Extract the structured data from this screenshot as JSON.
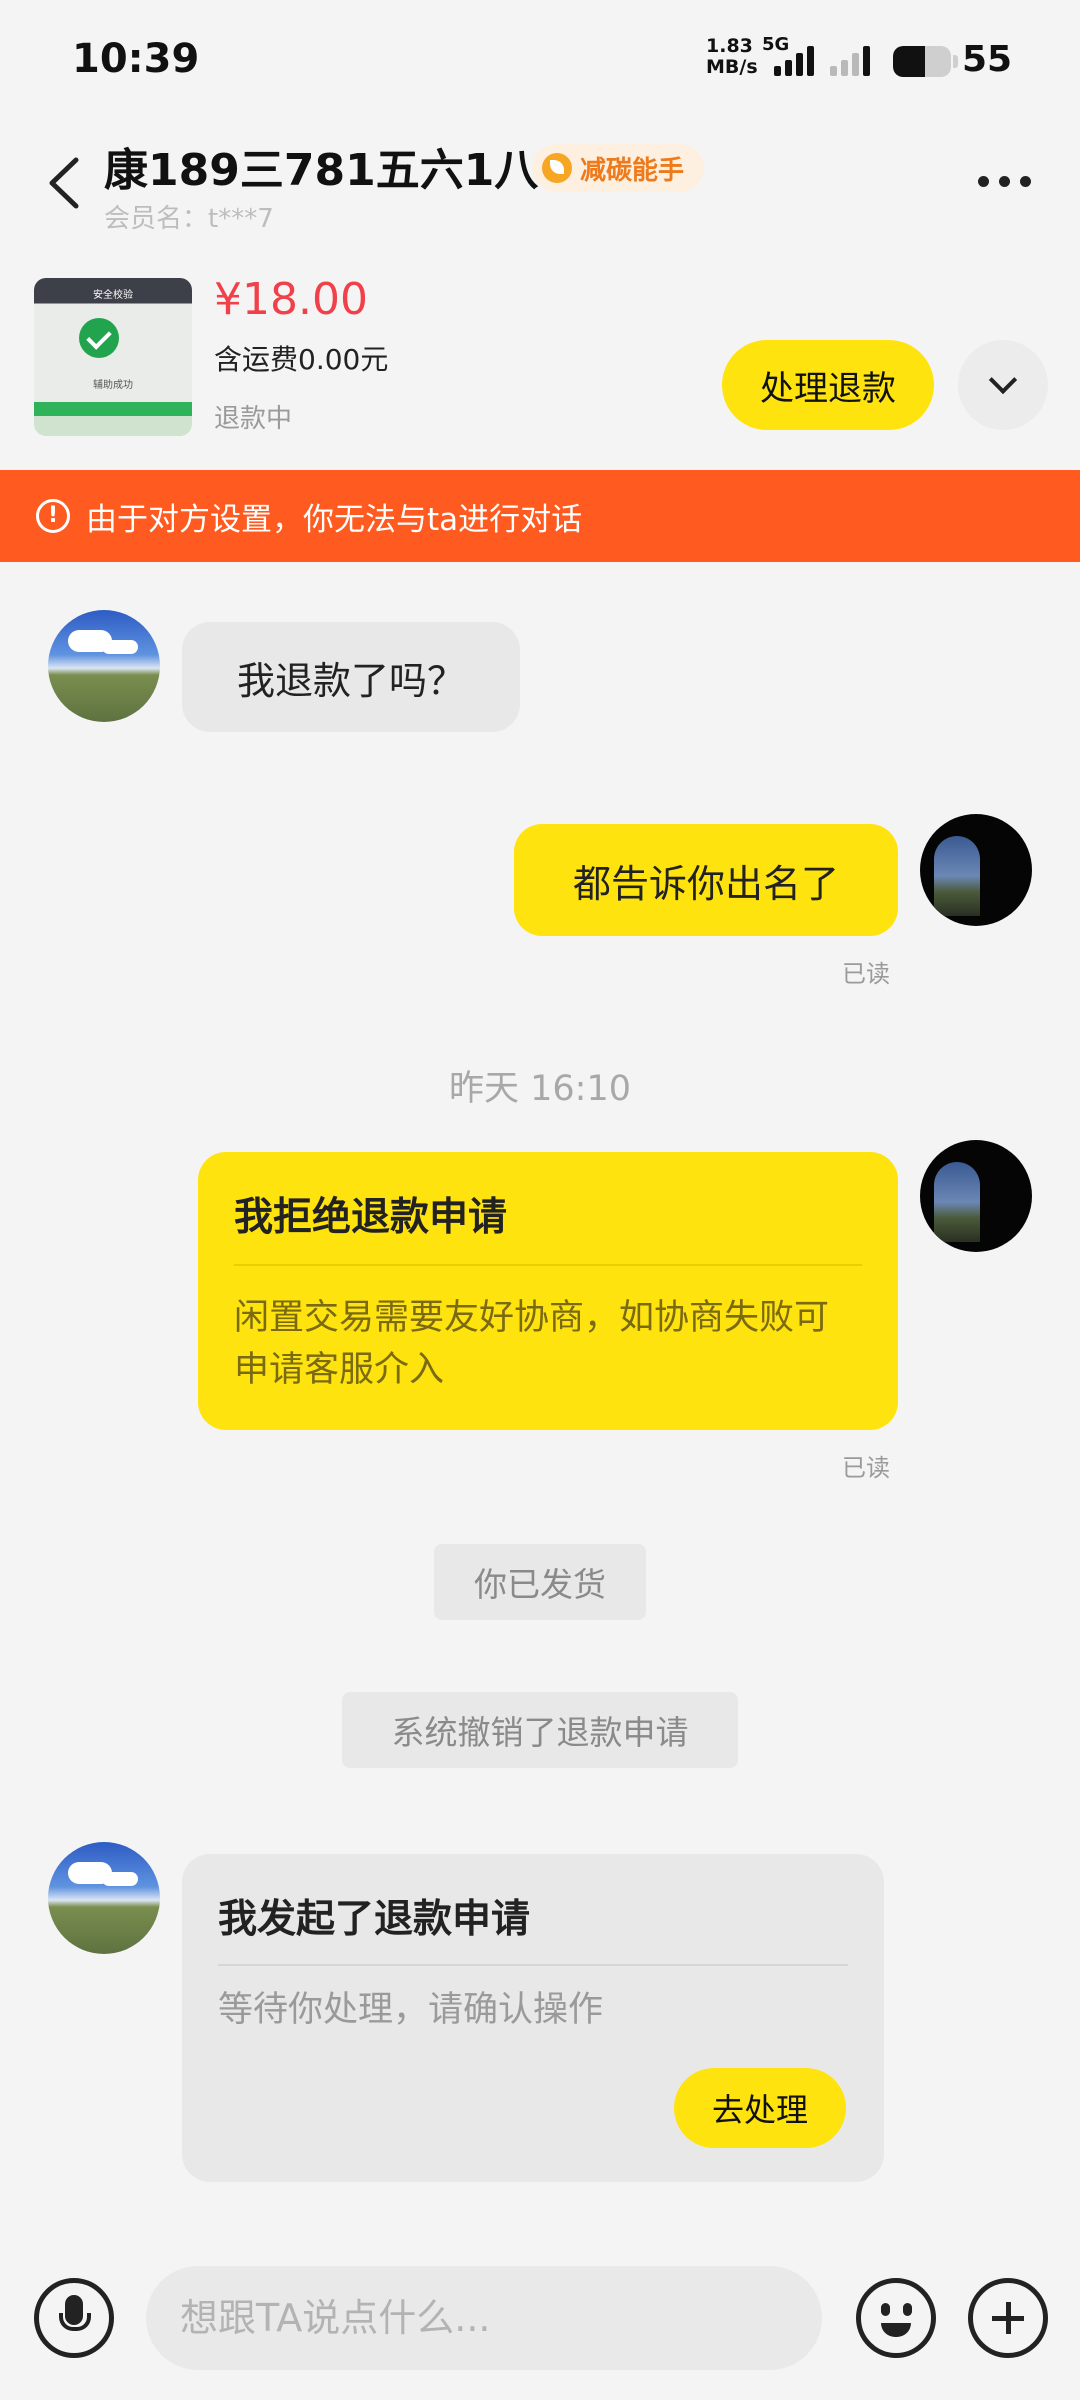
{
  "status_bar": {
    "time": "10:39",
    "net_speed_value": "1.83",
    "net_speed_unit": "MB/s",
    "network_type": "5G",
    "battery_percent": "55"
  },
  "header": {
    "contact_name": "康189三781五六1八",
    "badge": "减碳能手",
    "member_label": "会员名：t***7"
  },
  "product": {
    "thumb_title": "安全校验",
    "thumb_status": "辅助成功",
    "price": "¥18.00",
    "shipping": "含运费0.00元",
    "state": "退款中",
    "action_label": "处理退款"
  },
  "banner": {
    "icon_glyph": "!",
    "text": "由于对方设置，你无法与ta进行对话"
  },
  "messages": {
    "m1_text": "我退款了吗？",
    "m2_text": "都告诉你出名了",
    "m2_read": "已读",
    "timestamp": "昨天 16:10",
    "m3_title": "我拒绝退款申请",
    "m3_body": "闲置交易需要友好协商，如协商失败可申请客服介入",
    "m3_read": "已读",
    "sys_shipped": "你已发货",
    "sys_cancelled": "系统撤销了退款申请",
    "m4_title": "我发起了退款申请",
    "m4_body": "等待你处理，请确认操作",
    "m4_action": "去处理"
  },
  "input_bar": {
    "placeholder": "想跟TA说点什么..."
  }
}
